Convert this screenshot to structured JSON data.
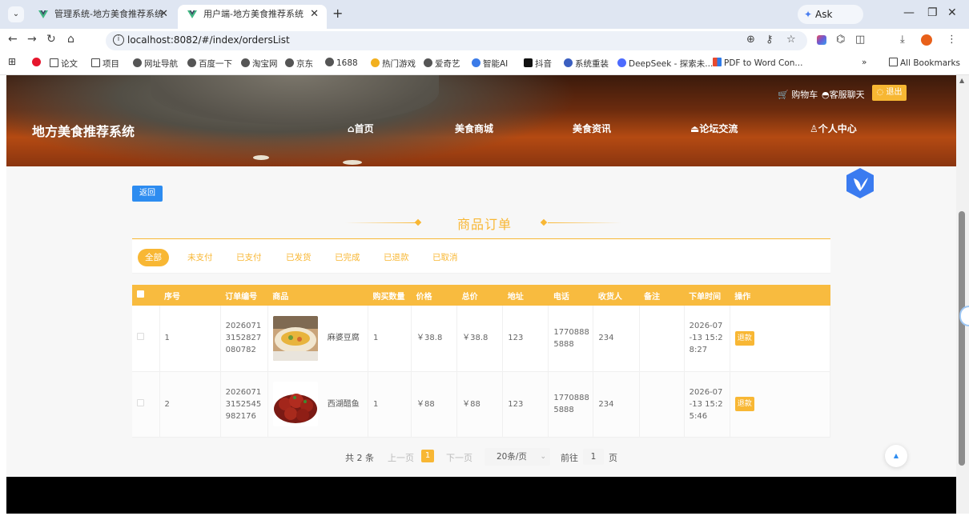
{
  "browser": {
    "tabs": [
      {
        "title": "管理系统-地方美食推荐系统",
        "active": false
      },
      {
        "title": "用户端-地方美食推荐系统",
        "active": true
      }
    ],
    "new_tab_glyph": "+",
    "ask_gemini": "Ask Gemini",
    "url": "localhost:8082/#/index/ordersList",
    "bookmarks": [
      {
        "label": "",
        "icon": "apps-grid-icon"
      },
      {
        "label": "",
        "icon": "weibo-icon"
      },
      {
        "label": "论文",
        "icon": "folder-icon"
      },
      {
        "label": "项目",
        "icon": "folder-icon"
      },
      {
        "label": "网址导航",
        "icon": "globe-icon"
      },
      {
        "label": "百度一下",
        "icon": "globe-icon"
      },
      {
        "label": "淘宝网",
        "icon": "globe-icon"
      },
      {
        "label": "京东",
        "icon": "globe-icon"
      },
      {
        "label": "1688",
        "icon": "globe-icon"
      },
      {
        "label": "热门游戏",
        "icon": "game-icon"
      },
      {
        "label": "爱奇艺",
        "icon": "globe-icon"
      },
      {
        "label": "智能AI",
        "icon": "ai-icon"
      },
      {
        "label": "抖音",
        "icon": "douyin-icon"
      },
      {
        "label": "系统重装",
        "icon": "system-icon"
      },
      {
        "label": "DeepSeek - 探索未...",
        "icon": "deepseek-icon"
      },
      {
        "label": "PDF to Word Con...",
        "icon": "pdf-icon"
      }
    ],
    "bookmarks_more": "»",
    "all_bookmarks": "All Bookmarks"
  },
  "site": {
    "brand": "地方美食推荐系统",
    "nav": [
      {
        "label": "⌂首页"
      },
      {
        "label": "美食商城"
      },
      {
        "label": "美食资讯"
      },
      {
        "label": "⏏论坛交流"
      },
      {
        "label": "♙个人中心"
      }
    ],
    "top_links": {
      "cart": "🛒 购物车",
      "chat": "◓客服聊天",
      "logout": "◌ 退出"
    }
  },
  "orders_page": {
    "back": "返回",
    "title": "商品订单",
    "status_tabs": [
      "全部",
      "未支付",
      "已支付",
      "已发货",
      "已完成",
      "已退款",
      "已取消"
    ],
    "active_tab": "全部",
    "columns": [
      "序号",
      "订单编号",
      "商品",
      "购买数量",
      "价格",
      "总价",
      "地址",
      "电话",
      "收货人",
      "备注",
      "下单时间",
      "操作"
    ],
    "rows": [
      {
        "index": "1",
        "order_no": "20260713152827080782",
        "product": "麻婆豆腐",
        "product_image": "wrap-food-image",
        "qty": "1",
        "price": "￥38.8",
        "total": "￥38.8",
        "address": "123",
        "phone": "17708885888",
        "receiver": "234",
        "note": "",
        "time": "2026-07-13 15:28:27",
        "action": "退款"
      },
      {
        "index": "2",
        "order_no": "20260713152545982176",
        "product": "西湖醋鱼",
        "product_image": "braised-meat-image",
        "qty": "1",
        "price": "￥88",
        "total": "￥88",
        "address": "123",
        "phone": "17708885888",
        "receiver": "234",
        "note": "",
        "time": "2026-07-13 15:25:46",
        "action": "退款"
      }
    ],
    "pagination": {
      "total": "共 2 条",
      "prev": "上一页",
      "current_page": "1",
      "next": "下一页",
      "page_size": "20条/页",
      "goto_label": "前往",
      "goto_value": "1",
      "page_unit": "页"
    }
  },
  "colors": {
    "accent": "#f8b734",
    "back_button": "#2d8cf0",
    "footer": "#000000"
  }
}
